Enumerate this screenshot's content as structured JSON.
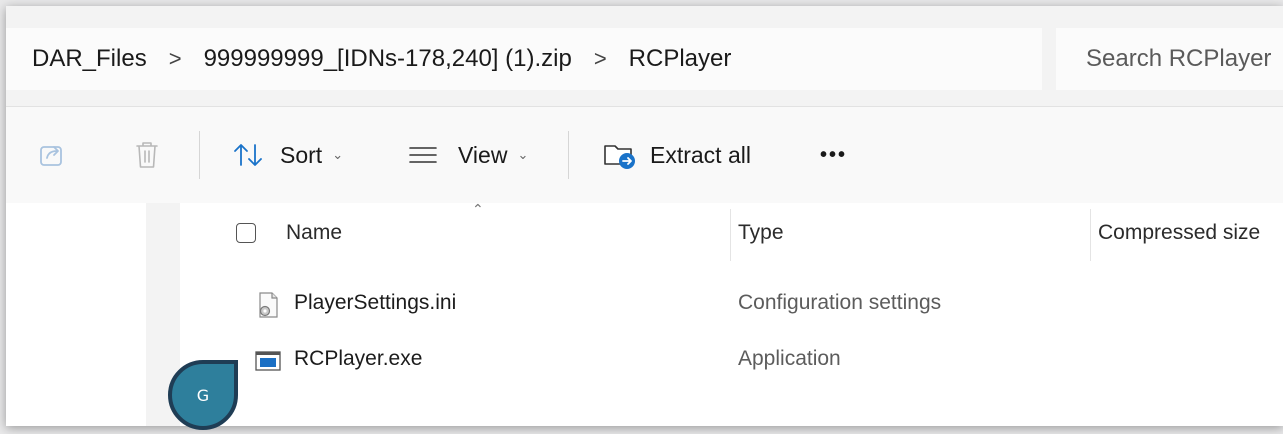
{
  "breadcrumb": {
    "items": [
      "DAR_Files",
      "999999999_[IDNs-178,240] (1).zip",
      "RCPlayer"
    ],
    "separator": ">"
  },
  "search": {
    "placeholder": "Search RCPlayer"
  },
  "toolbar": {
    "share_icon": "share-icon",
    "delete_icon": "trash-icon",
    "sort_label": "Sort",
    "view_label": "View",
    "extract_label": "Extract all",
    "more_label": "•••"
  },
  "columns": {
    "name": "Name",
    "type": "Type",
    "compressed_size": "Compressed size"
  },
  "files": [
    {
      "name": "PlayerSettings.ini",
      "type": "Configuration settings",
      "icon": "settings-file-icon"
    },
    {
      "name": "RCPlayer.exe",
      "type": "Application",
      "icon": "application-icon"
    }
  ],
  "user_marker": {
    "initial": "G",
    "color": "#2e7f9c"
  },
  "colors": {
    "accent": "#1a73c9"
  }
}
